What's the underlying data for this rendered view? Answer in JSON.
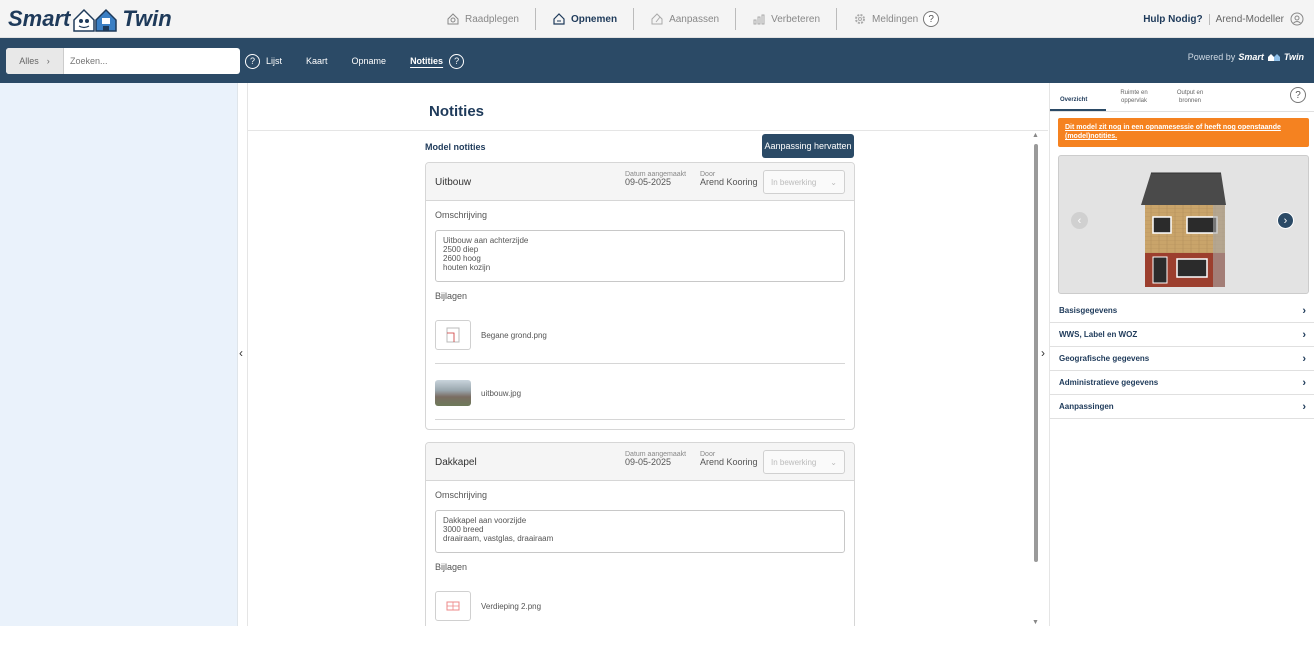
{
  "app": {
    "logo_left": "Smart",
    "logo_right": "Twin",
    "powered_by": "Powered by",
    "powered_brand_left": "Smart",
    "powered_brand_right": "Twin"
  },
  "topnav": {
    "items": [
      {
        "label": "Raadplegen",
        "icon": "search-house-icon",
        "active": false
      },
      {
        "label": "Opnemen",
        "icon": "house-icon",
        "active": true
      },
      {
        "label": "Aanpassen",
        "icon": "edit-house-icon",
        "active": false
      },
      {
        "label": "Verbeteren",
        "icon": "chart-icon",
        "active": false
      },
      {
        "label": "Meldingen",
        "icon": "gear-icon",
        "active": false
      }
    ],
    "help_mark": "?",
    "help_label": "Hulp Nodig?",
    "user": "Arend-Modeller"
  },
  "navbar": {
    "scope": "Alles",
    "search_placeholder": "Zoeken...",
    "help_mark": "?",
    "links": [
      {
        "label": "Lijst",
        "active": false
      },
      {
        "label": "Kaart",
        "active": false
      },
      {
        "label": "Opname",
        "active": false
      },
      {
        "label": "Notities",
        "active": true
      }
    ]
  },
  "main": {
    "title": "Notities",
    "section": "Model notities",
    "resume_button": "Aanpassing hervatten",
    "cards": [
      {
        "name": "Uitbouw",
        "date_label": "Datum aangemaakt",
        "date": "09-05-2025",
        "by_label": "Door",
        "by": "Arend Kooring",
        "status": "In bewerking",
        "desc_label": "Omschrijving",
        "description": "Uitbouw aan achterzijde\n2500 diep\n2600 hoog\nhouten kozijn",
        "att_label": "Bijlagen",
        "attachments": [
          "Begane grond.png",
          "uitbouw.jpg"
        ]
      },
      {
        "name": "Dakkapel",
        "date_label": "Datum aangemaakt",
        "date": "09-05-2025",
        "by_label": "Door",
        "by": "Arend Kooring",
        "status": "In bewerking",
        "desc_label": "Omschrijving",
        "description": "Dakkapel aan voorzijde\n3000 breed\ndraairaam, vastglas, draairaam",
        "att_label": "Bijlagen",
        "attachments": [
          "Verdieping 2.png"
        ]
      }
    ]
  },
  "right": {
    "tabs": [
      {
        "label": "Overzicht",
        "active": true
      },
      {
        "label": "Ruimte en oppervlak",
        "active": false
      },
      {
        "label": "Output en bronnen",
        "active": false
      }
    ],
    "help_mark": "?",
    "alert": "Dit model zit nog in een opnamesessie of heeft nog openstaande (model)notities.",
    "sections": [
      "Basisgegevens",
      "WWS, Label en WOZ",
      "Geografische gegevens",
      "Administratieve gegevens",
      "Aanpassingen"
    ]
  },
  "colors": {
    "brand_dark": "#2b4a66",
    "accent_orange": "#f58220",
    "left_panel": "#eaf2fb"
  }
}
